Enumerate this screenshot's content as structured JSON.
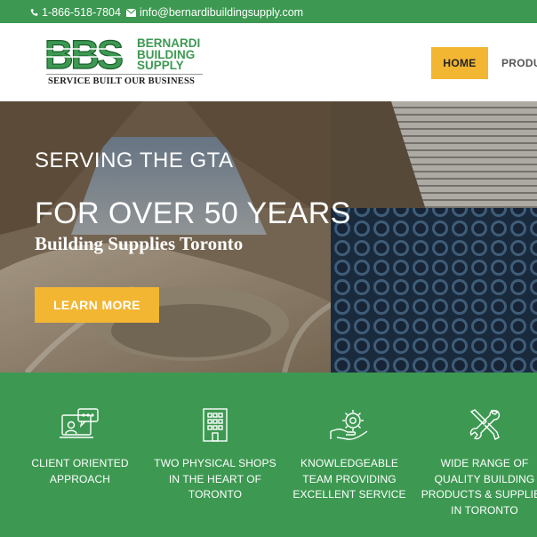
{
  "topbar": {
    "phone": "1-866-518-7804",
    "email": "info@bernardibuildingsupply.com",
    "phone_icon": "phone-icon",
    "email_icon": "envelope-icon"
  },
  "header": {
    "logo": {
      "initials": "BBS",
      "name_lines": [
        "BERNARDI",
        "BUILDING",
        "SUPPLY"
      ],
      "tagline": "SERVICE BUILT OUR BUSINESS"
    },
    "nav": {
      "home": "HOME",
      "products": "PRODU"
    }
  },
  "hero": {
    "heading_small": "SERVING THE GTA",
    "heading_large": "FOR OVER 50 YEARS",
    "subheading": "Building Supplies Toronto",
    "cta_label": "LEARN MORE"
  },
  "features": [
    {
      "icon": "customer-chat-icon",
      "lines": [
        "CLIENT ORIENTED",
        "APPROACH"
      ]
    },
    {
      "icon": "building-icon",
      "lines": [
        "TWO PHYSICAL SHOPS",
        "IN THE HEART OF",
        "TORONTO"
      ]
    },
    {
      "icon": "gear-hand-icon",
      "lines": [
        "KNOWLEDGEABLE",
        "TEAM PROVIDING",
        "EXCELLENT SERVICE"
      ]
    },
    {
      "icon": "tools-icon",
      "lines": [
        "WIDE RANGE OF",
        "QUALITY BUILDING",
        "PRODUCTS & SUPPLIES",
        "IN TORONTO"
      ]
    }
  ],
  "colors": {
    "brand_green": "#3d9952",
    "accent_yellow": "#f2b632"
  }
}
